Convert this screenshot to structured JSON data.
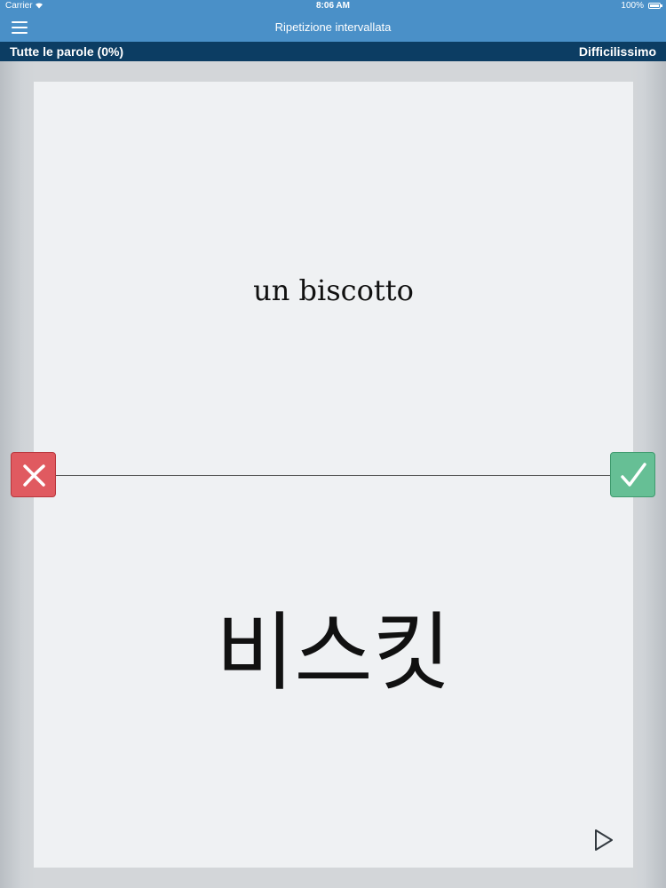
{
  "status_bar": {
    "carrier": "Carrier",
    "time": "8:06 AM",
    "battery": "100%"
  },
  "nav": {
    "title": "Ripetizione intervallata",
    "menu_icon": "hamburger-menu-icon"
  },
  "progress_bar": {
    "left_label": "Tutte le parole (0%)",
    "right_label": "Difficilissimo"
  },
  "card": {
    "front_text": "un biscotto",
    "back_text": "비스킷"
  },
  "actions": {
    "wrong_icon": "close-icon",
    "right_icon": "checkmark-icon",
    "play_icon": "play-icon",
    "wrong_color": "#e05a60",
    "right_color": "#66bf95"
  },
  "colors": {
    "nav_bg": "#4a90c8",
    "sub_bar_bg": "#0c3d63",
    "card_bg": "#eff1f3"
  }
}
